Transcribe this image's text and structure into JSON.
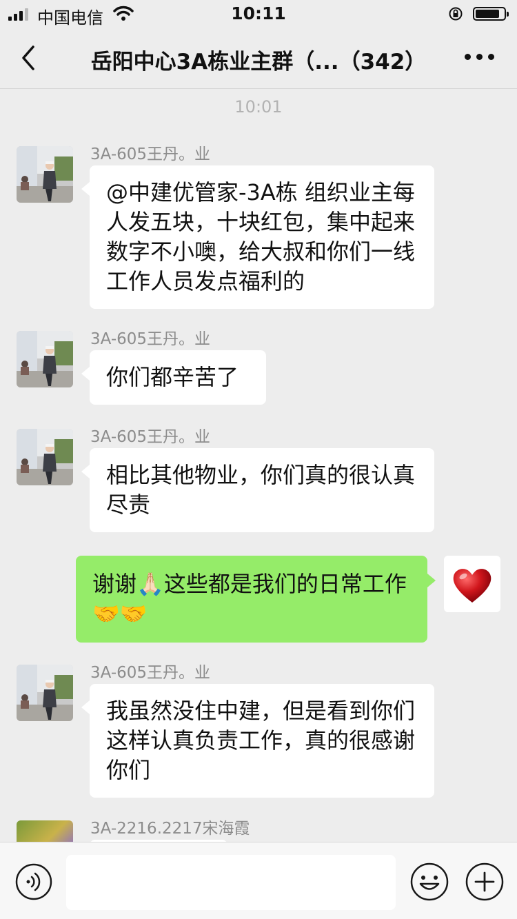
{
  "status_bar": {
    "carrier": "中国电信",
    "time": "10:11",
    "battery_level": 0.85
  },
  "nav": {
    "title": "岳阳中心3A栋业主群（...（342）"
  },
  "chat": {
    "timestamp": "10:01",
    "messages": [
      {
        "sender": "3A-605王丹。业",
        "text": "@中建优管家-3A栋 组织业主每人发五块，十块红包，集中起来数字不小噢，给大叔和你们一线工作人员发点福利的"
      },
      {
        "sender": "3A-605王丹。业",
        "text": "你们都辛苦了"
      },
      {
        "sender": "3A-605王丹。业",
        "text": "相比其他物业，你们真的很认真尽责"
      },
      {
        "self": true,
        "text": "谢谢🙏🏻这些都是我们的日常工作🤝🤝"
      },
      {
        "sender": "3A-605王丹。业",
        "text": "我虽然没住中建，但是看到你们这样认真负责工作，真的很感谢你们"
      },
      {
        "sender": "3A-2216.2217宋海霞",
        "text": ""
      }
    ]
  },
  "icons": {
    "back": "chevron-left-icon",
    "more": "more-dots-icon",
    "voice": "voice-icon",
    "emoji": "emoji-icon",
    "plus": "plus-icon"
  },
  "colors": {
    "background": "#ededed",
    "incoming_bubble": "#ffffff",
    "outgoing_bubble": "#95ec69",
    "sender_name": "#8c8c8c",
    "timestamp": "#b2b2b2"
  }
}
